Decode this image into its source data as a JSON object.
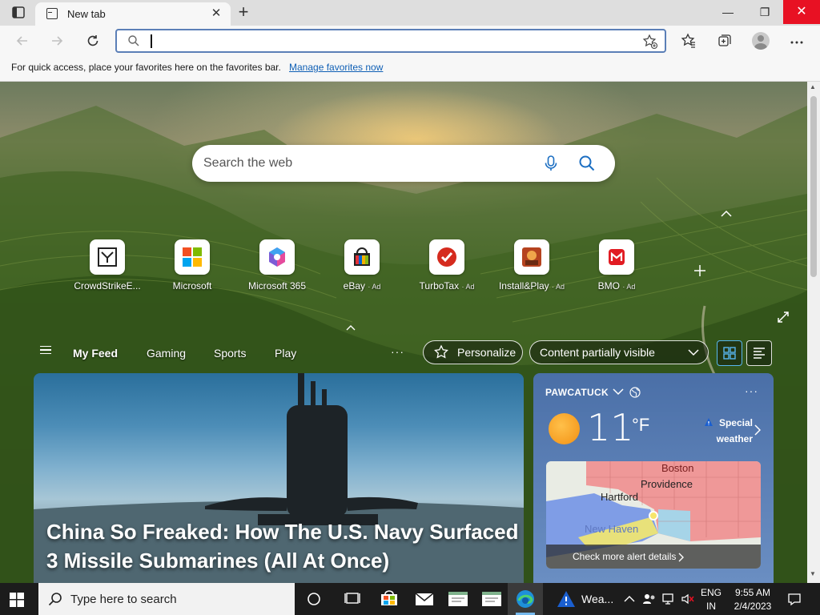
{
  "browser": {
    "tab_title": "New tab",
    "tab_close": "✕",
    "new_tab": "+",
    "window": {
      "minimize": "—",
      "maximize": "❐",
      "close": "✕"
    },
    "address": {
      "value": "",
      "placeholder": ""
    },
    "favorites_bar": {
      "message": "For quick access, place your favorites here on the favorites bar.",
      "link": "Manage favorites now"
    }
  },
  "newtab": {
    "search_placeholder": "Search the web",
    "tiles": [
      {
        "label": "CrowdStrikeE...",
        "ad": "",
        "icon": "crowdstrike-icon"
      },
      {
        "label": "Microsoft",
        "ad": "",
        "icon": "microsoft-icon"
      },
      {
        "label": "Microsoft 365",
        "ad": "",
        "icon": "microsoft365-icon"
      },
      {
        "label": "eBay",
        "ad": "· Ad",
        "icon": "ebay-icon"
      },
      {
        "label": "TurboTax",
        "ad": "· Ad",
        "icon": "turbotax-icon"
      },
      {
        "label": "Install&Play",
        "ad": "· Ad",
        "icon": "installplay-icon"
      },
      {
        "label": "BMO",
        "ad": "· Ad",
        "icon": "bmo-icon"
      }
    ],
    "feed_nav": {
      "items": [
        "My Feed",
        "Gaming",
        "Sports",
        "Play"
      ],
      "more": "···",
      "personalize": "Personalize",
      "content_visibility": "Content partially visible"
    },
    "hero": {
      "headline": "China So Freaked: How The U.S. Navy Surfaced 3 Missile Submarines (All At Once)"
    },
    "weather": {
      "location": "PAWCATUCK",
      "temperature": "11",
      "unit": "°F",
      "alert": "Special weather",
      "more": "···",
      "map_cities": [
        "Boston",
        "Providence",
        "Hartford",
        "New Haven"
      ],
      "map_footer": "Check more alert details"
    }
  },
  "taskbar": {
    "search_placeholder": "Type here to search",
    "weather_label": "Wea...",
    "language_top": "ENG",
    "language_bottom": "IN",
    "time": "9:55 AM",
    "date": "2/4/2023"
  },
  "colors": {
    "accent": "#0f5fb5",
    "close_red": "#e81123",
    "weather_card": "#5c80b6",
    "taskbar": "#1c1c1c"
  }
}
